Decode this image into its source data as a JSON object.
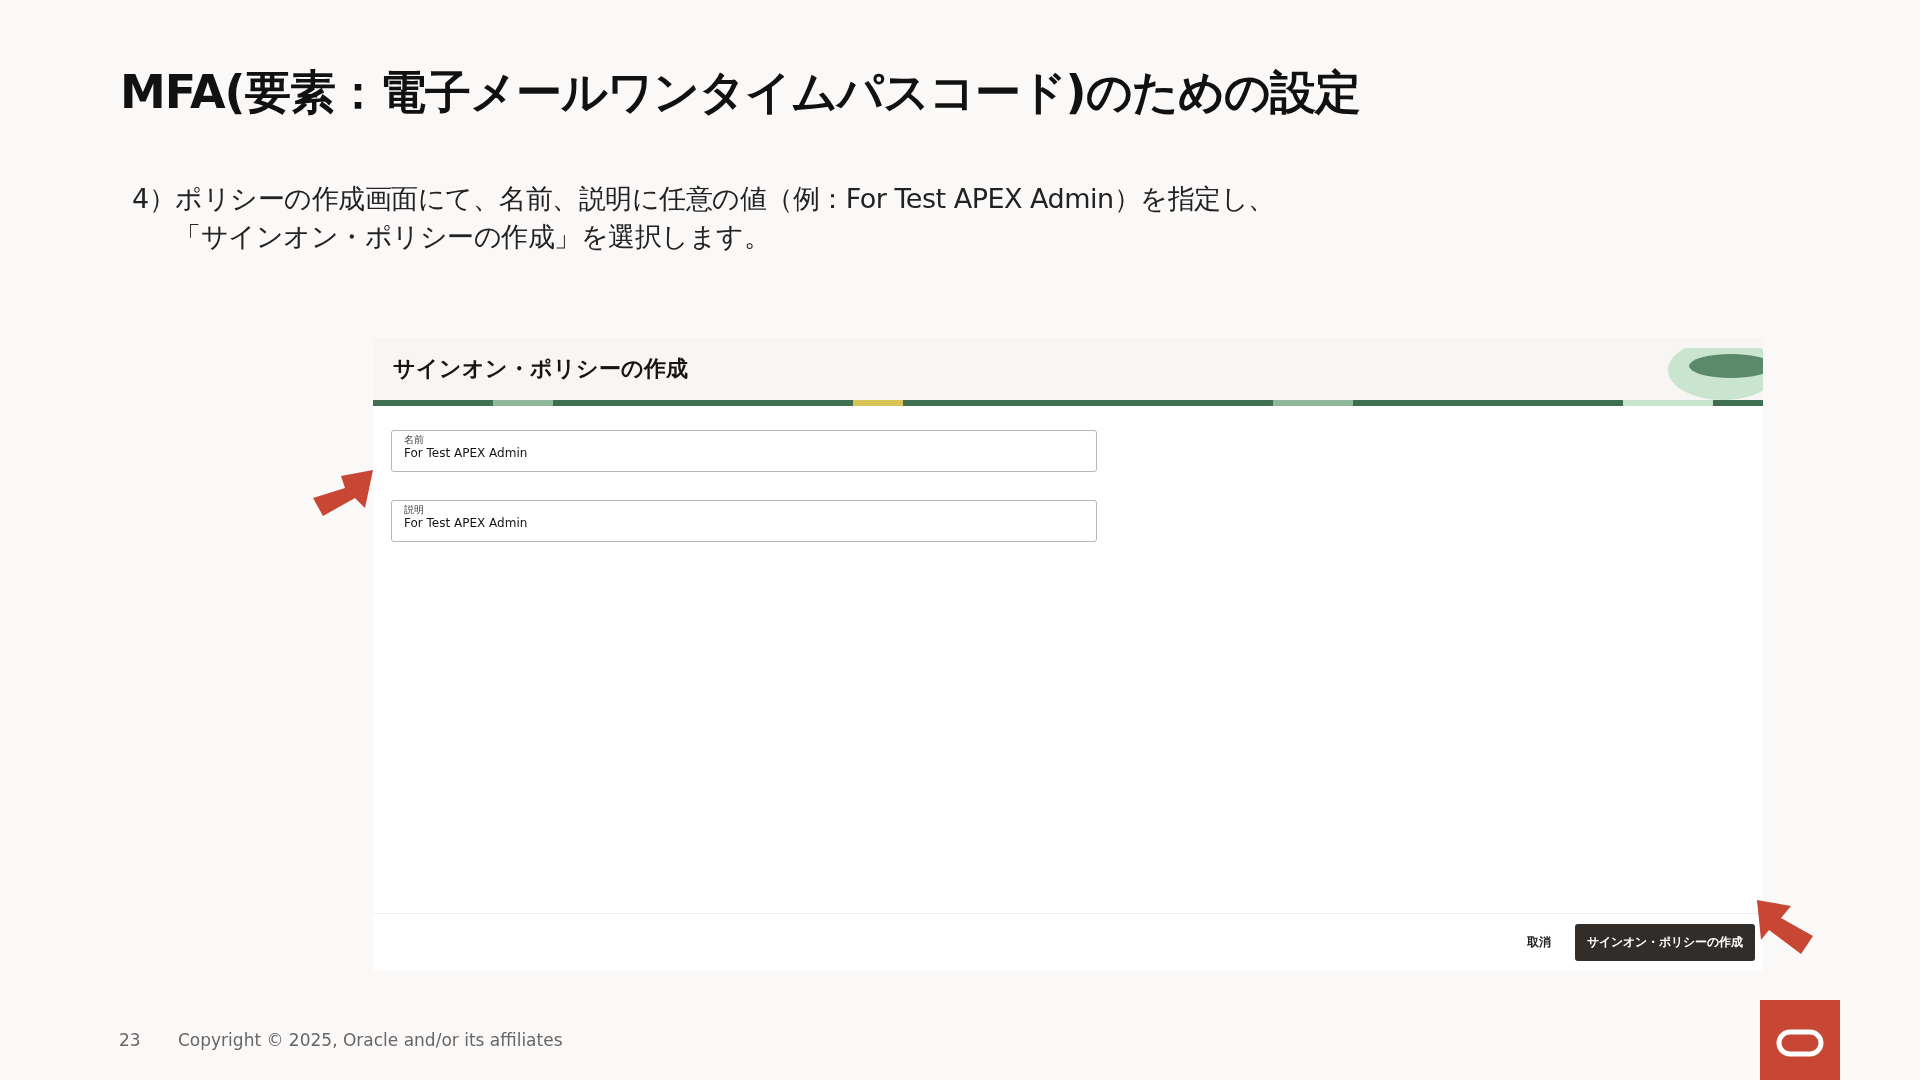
{
  "slide_title": "MFA(要素：電子メールワンタイムパスコード)のための設定",
  "instruction": {
    "lines": [
      "4）ポリシーの作成画面にて、名前、説明に任意の値（例：For Test APEX Admin）を指定し、",
      "「サインオン・ポリシーの作成」を選択します。"
    ]
  },
  "screenshot": {
    "header_title": "サインオン・ポリシーの作成",
    "fields": [
      {
        "label": "名前",
        "value": "For Test APEX Admin"
      },
      {
        "label": "説明",
        "value": "For Test APEX Admin"
      }
    ],
    "buttons": [
      {
        "label": "取消",
        "kind": "secondary"
      },
      {
        "label": "サインオン・ポリシーの作成",
        "kind": "primary"
      }
    ]
  },
  "footer": {
    "page_number": "23",
    "copyright": "Copyright © 2025, Oracle and/or its affiliates"
  }
}
